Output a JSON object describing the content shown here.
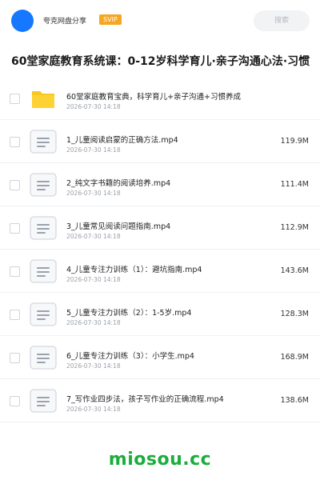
{
  "header": {
    "user_name": "夸克网盘分享",
    "badge": "SVIP",
    "search_placeholder": "搜索",
    "accent_color": "#1677ff",
    "badge_color": "#f5a623"
  },
  "title": "60堂家庭教育系统课：0-12岁科学育儿·亲子沟通心法·习惯",
  "files": [
    {
      "icon": "folder-icon",
      "name": "60堂家庭教育宝典，科学育儿+亲子沟通+习惯养成",
      "date": "2026-07-30 14:18",
      "size": ""
    },
    {
      "icon": "document-icon",
      "name": "1_儿童阅读启蒙的正确方法.mp4",
      "date": "2026-07-30 14:18",
      "size": "119.9M"
    },
    {
      "icon": "document-icon",
      "name": "2_纯文字书籍的阅读培养.mp4",
      "date": "2026-07-30 14:18",
      "size": "111.4M"
    },
    {
      "icon": "document-icon",
      "name": "3_儿童常见阅读问题指南.mp4",
      "date": "2026-07-30 14:18",
      "size": "112.9M"
    },
    {
      "icon": "document-icon",
      "name": "4_儿童专注力训练（1）：避坑指南.mp4",
      "date": "2026-07-30 14:18",
      "size": "143.6M"
    },
    {
      "icon": "document-icon",
      "name": "5_儿童专注力训练（2）：1-5岁.mp4",
      "date": "2026-07-30 14:18",
      "size": "128.3M"
    },
    {
      "icon": "document-icon",
      "name": "6_儿童专注力训练（3）：小学生.mp4",
      "date": "2026-07-30 14:18",
      "size": "168.9M"
    },
    {
      "icon": "document-icon",
      "name": "7_写作业四步法，孩子写作业的正确流程.mp4",
      "date": "2026-07-30 14:18",
      "size": "138.6M"
    }
  ],
  "watermark": "miosou.cc",
  "watermark_color": "#1aad3b"
}
